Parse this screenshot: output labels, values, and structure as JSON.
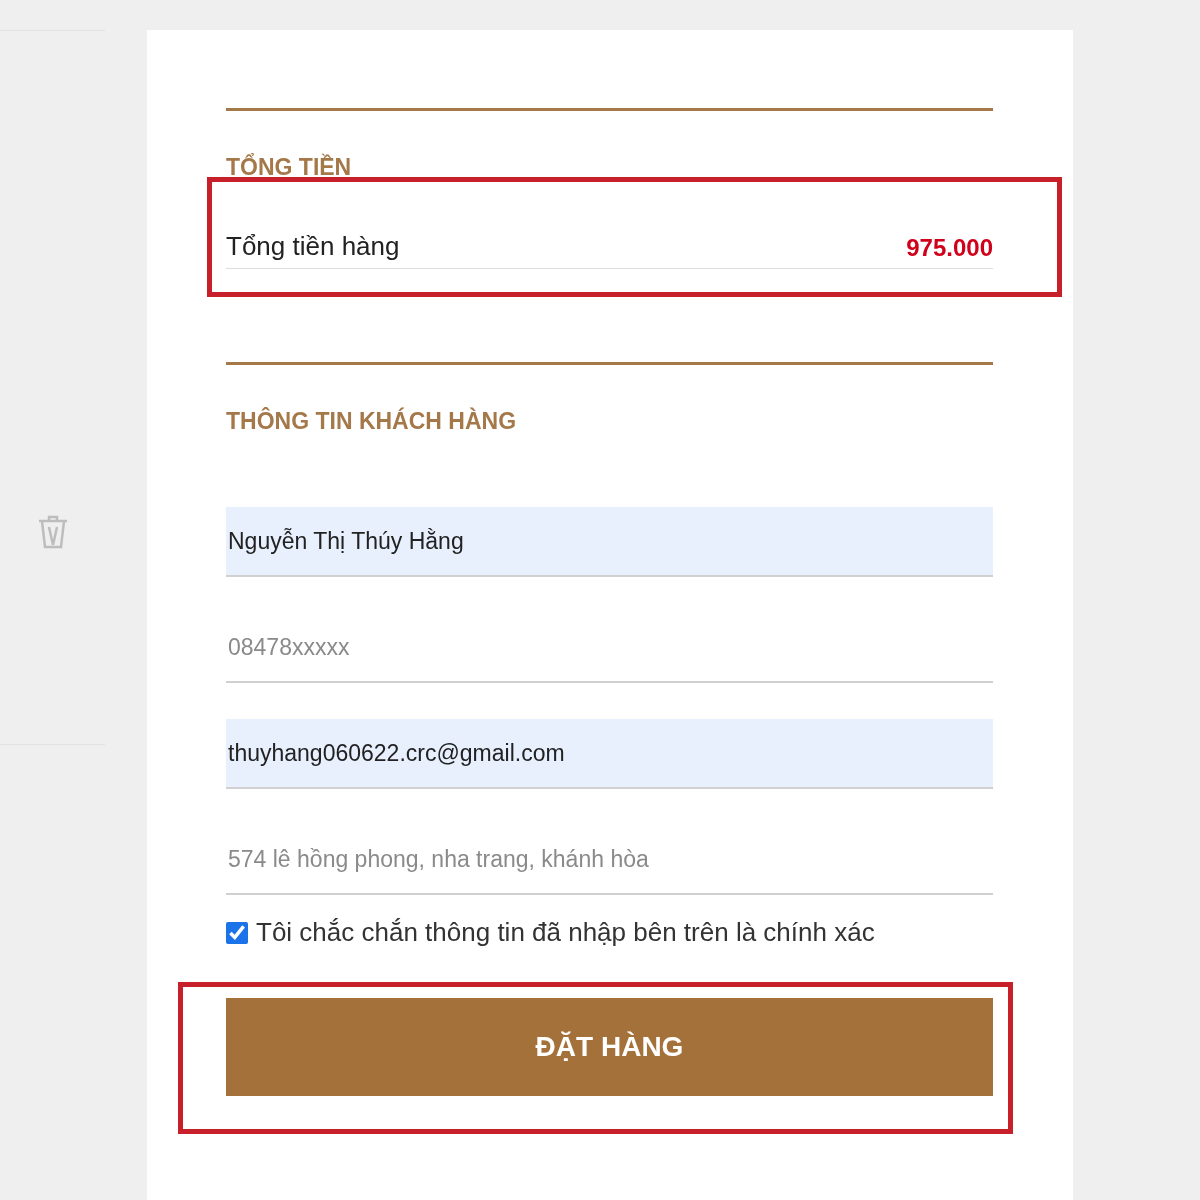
{
  "total_section": {
    "heading": "TỔNG TIỀN",
    "label": "Tổng tiền hàng",
    "amount": "975.000",
    "highlighted": true
  },
  "customer_section": {
    "heading": "THÔNG TIN KHÁCH HÀNG",
    "fields": [
      {
        "value": "Nguyễn Thị Thúy Hằng",
        "autofilled": true
      },
      {
        "value": "08478xxxxx",
        "autofilled": false
      },
      {
        "value": "thuyhang060622.crc@gmail.com",
        "autofilled": true
      },
      {
        "value": "574 lê hồng phong, nha trang, khánh hòa",
        "autofilled": false
      }
    ],
    "confirm": {
      "label": "Tôi chắc chắn thông tin đã nhập bên trên là chính xác",
      "checked": true
    }
  },
  "order_button": {
    "label": "ĐẶT HÀNG",
    "highlighted": true
  }
}
